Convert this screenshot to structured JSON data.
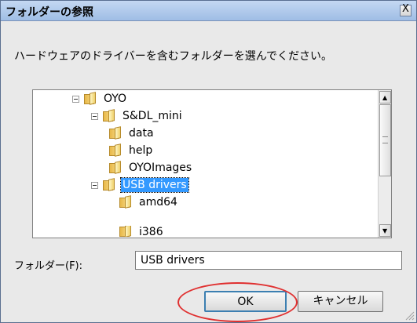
{
  "dialog": {
    "title": "フォルダーの参照",
    "close_glyph": "X",
    "instruction": "ハードウェアのドライバーを含むフォルダーを選んでください。"
  },
  "tree": {
    "items": [
      {
        "label": "OYO",
        "expanded": true,
        "selected": false
      },
      {
        "label": "S&DL_mini",
        "expanded": true,
        "selected": false
      },
      {
        "label": "data",
        "expanded": false,
        "selected": false
      },
      {
        "label": "help",
        "expanded": false,
        "selected": false
      },
      {
        "label": "OYOImages",
        "expanded": false,
        "selected": false
      },
      {
        "label": "USB drivers",
        "expanded": true,
        "selected": true
      },
      {
        "label": "amd64",
        "expanded": false,
        "selected": false
      },
      {
        "label": "i386",
        "expanded": false,
        "selected": false
      }
    ],
    "scroll": {
      "up_glyph": "▲",
      "down_glyph": "▼"
    }
  },
  "folder_field": {
    "label": "フォルダー(F):",
    "value": "USB drivers"
  },
  "buttons": {
    "ok": "OK",
    "cancel": "キャンセル"
  },
  "colors": {
    "selection": "#3399ff",
    "annotation_oval": "#e03030"
  }
}
